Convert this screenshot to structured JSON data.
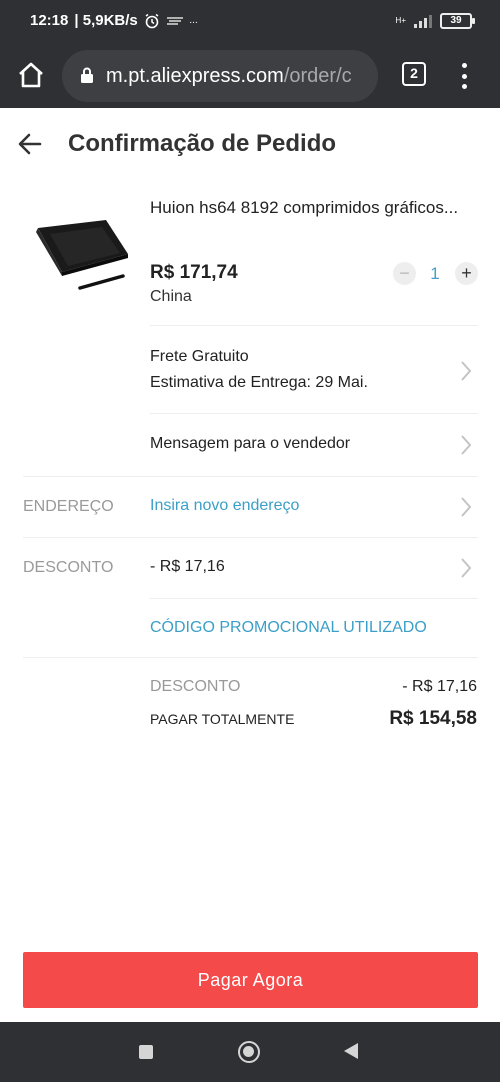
{
  "status_bar": {
    "time": "12:18",
    "speed": "| 5,9KB/s",
    "extra": "...",
    "network": "H+",
    "battery": "39"
  },
  "browser": {
    "url_host": "m.pt.aliexpress.com",
    "url_path": "/order/c",
    "tab_count": "2"
  },
  "header": {
    "title": "Confirmação de Pedido"
  },
  "product": {
    "name": "Huion hs64 8192 comprimidos gráficos...",
    "price": "R$ 171,74",
    "origin": "China",
    "quantity": "1",
    "minus": "−",
    "plus": "+"
  },
  "shipping": {
    "line1": "Frete Gratuito",
    "line2": "Estimativa de Entrega: 29 Mai."
  },
  "message": {
    "label": "Mensagem para o vendedor"
  },
  "address": {
    "label": "ENDEREÇO",
    "value": "Insira novo endereço"
  },
  "discount": {
    "label": "DESCONTO",
    "value": "- R$ 17,16",
    "promo": "CÓDIGO PROMOCIONAL UTILIZADO"
  },
  "summary": {
    "discount_label": "DESCONTO",
    "discount_value": "- R$ 17,16",
    "total_label": "PAGAR TOTALMENTE",
    "total_value": "R$ 154,58"
  },
  "pay_button": {
    "label": "Pagar Agora"
  },
  "colors": {
    "accent": "#f44a4a",
    "link": "#3c9fc7",
    "bar": "#2f3033"
  }
}
